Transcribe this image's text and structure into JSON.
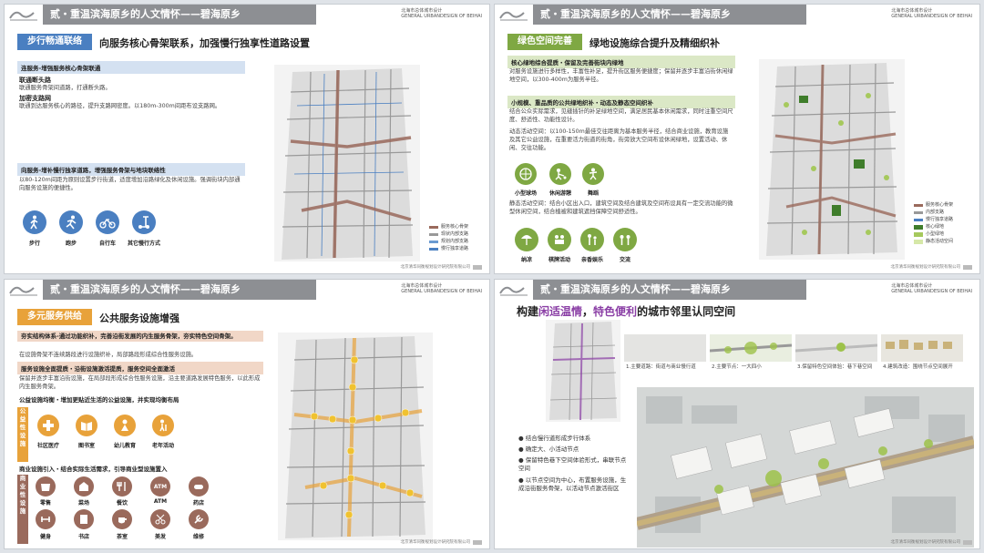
{
  "common": {
    "section_title": "贰・重温滨海原乡的人文情怀——碧海原乡",
    "project_cn": "北海市总体城市设计",
    "project_en": "GENERAL URBANDESIGN OF BEIHAI",
    "footer_org": "北京清华同衡规划设计研究院有限公司",
    "colors": {
      "blue": "#4a7fc1",
      "green": "#7fa843",
      "orange": "#e8a23a",
      "brown": "#9a6a5c",
      "grey": "#8d8f93"
    }
  },
  "slide1": {
    "tag": "步行畅通联络",
    "heading": "向服务核心骨架联系，加强慢行独享性道路设置",
    "band1": "连服务-增强服务核心骨架联通",
    "items": [
      {
        "title": "联通断头路",
        "body": "联通服务骨架间道路，打通断头路。"
      },
      {
        "title": "加密支路网",
        "body": "联通到达服务核心的路径，提升支路网密度。以180m-300m间距布设支路网。"
      }
    ],
    "band2": "向服务-增补慢行独享道路，增强服务骨架与地块联络性",
    "band2_body": "以80-120m间距为原则设置步行街道，适度增加沿路绿化及休闲设施。强调街块内部通向服务设施的便捷性。",
    "icons": [
      {
        "label": "步行",
        "icon": "walk-icon"
      },
      {
        "label": "跑步",
        "icon": "run-icon"
      },
      {
        "label": "自行车",
        "icon": "bike-icon"
      },
      {
        "label": "其它慢行方式",
        "icon": "scooter-icon"
      }
    ],
    "legend": [
      "服务核心骨架",
      "现状内部支路",
      "规划内部支路",
      "慢行独享道路"
    ]
  },
  "slide2": {
    "tag": "绿色空间完善",
    "heading": "绿地设施综合提升及精细织补",
    "band1": "核心绿地综合提质・保留及完善街块内绿地",
    "band1_body": "对服务设施进行多样性，丰富性补足，提升街区服务便捷度；保留并逐步丰富沿街休闲绿地空间，以300-400m为服务半径。",
    "band2": "小规模、重品质的公共绿地织补・动态及静态空间织补",
    "band2_body": "结合公众实际需求，见缝插针的补足绿地空间，满足居民基本休闲需求，同时注重空间尺度、舒适性、功能性设计。",
    "dyn": "动态活动空间：以100-150m最佳交往距离为基本服务半径，结合商业设施，教育设施及其它公益设施，在重要活力街道的街角，街旁放大空间布设休闲绿地，设置活动、休闲、交往功能。",
    "static": "静态活动空间：结合小区出入口，建筑空间及结合建筑及空间布设具有一定交流功能的微型休闲空间，结合植被和建筑遮挡保障空间舒适性。",
    "icons_top": [
      {
        "label": "小型球场",
        "icon": "ball-icon"
      },
      {
        "label": "休闲游憩",
        "icon": "leisure-icon"
      },
      {
        "label": "舞蹈",
        "icon": "dance-icon"
      }
    ],
    "icons_bottom": [
      {
        "label": "纳凉",
        "icon": "shade-icon"
      },
      {
        "label": "棋牌活动",
        "icon": "chess-icon"
      },
      {
        "label": "亲香娱乐",
        "icon": "family-icon"
      },
      {
        "label": "交流",
        "icon": "chat-icon"
      }
    ],
    "legend": [
      "服务核心骨架",
      "内部支路",
      "慢行独享道路",
      "核心绿地",
      "小型绿地",
      "静态活动空间"
    ]
  },
  "slide3": {
    "tag": "多元服务供给",
    "heading": "公共服务设施增强",
    "band1": "夯实结构体系-通过功能织补，完善沿街发展的内生服务骨架，夯实特色空间骨架。",
    "band1_body": "在设施骨架不连续路段进行设施织补，局部路段形成综合性服务设施。",
    "band2": "服务设施全面提质・沿街设施激活提质，服务空间全面激活",
    "band2_body": "保留并逐步丰富沿街设施，在局部段形成综合性服务设施，沿主要道路发展特色服务，以此形成内生服务骨架。",
    "sub1": "公益设施均衡・增加更贴近生活的公益设施，并实现均衡布局",
    "vbar1": "公益性设施",
    "icons_public": [
      {
        "label": "社区医疗",
        "icon": "medical-icon"
      },
      {
        "label": "图书室",
        "icon": "library-icon"
      },
      {
        "label": "幼儿教育",
        "icon": "child-icon"
      },
      {
        "label": "老年活动",
        "icon": "elder-icon"
      }
    ],
    "sub2": "商业设施引入・结合实际生活需求，引导商业型设施置入",
    "vbar2": "商业性设施",
    "icons_commercial": [
      {
        "label": "零售",
        "icon": "retail-icon"
      },
      {
        "label": "菜场",
        "icon": "market-icon"
      },
      {
        "label": "餐饮",
        "icon": "food-icon"
      },
      {
        "label": "ATM",
        "icon": "atm-icon"
      },
      {
        "label": "药店",
        "icon": "pharmacy-icon"
      },
      {
        "label": "健身",
        "icon": "fitness-icon"
      },
      {
        "label": "书店",
        "icon": "bookstore-icon"
      },
      {
        "label": "茶室",
        "icon": "tea-icon"
      },
      {
        "label": "美发",
        "icon": "hair-icon"
      },
      {
        "label": "维修",
        "icon": "repair-icon"
      }
    ]
  },
  "slide4": {
    "heading_pre": "构建",
    "heading_hl1": "闲适温情",
    "heading_mid": "，",
    "heading_hl2": "特色便利",
    "heading_post": "的城市邻里认同空间",
    "steps": [
      "1.主要道路：街道与商业慢行道",
      "2.主要节点：一大四小",
      "3.保留特色空间体验：巷下巷空间",
      "4.建筑改造：围绕节点空间展开"
    ],
    "bullets": [
      "结合慢行道形成步行体系",
      "确定大、小活动节点",
      "保留特色巷下空间体验形式，串联节点空间",
      "以节点空间为中心，布置服务设施，生成沿街服务骨架，以活动节点激活街区"
    ]
  }
}
